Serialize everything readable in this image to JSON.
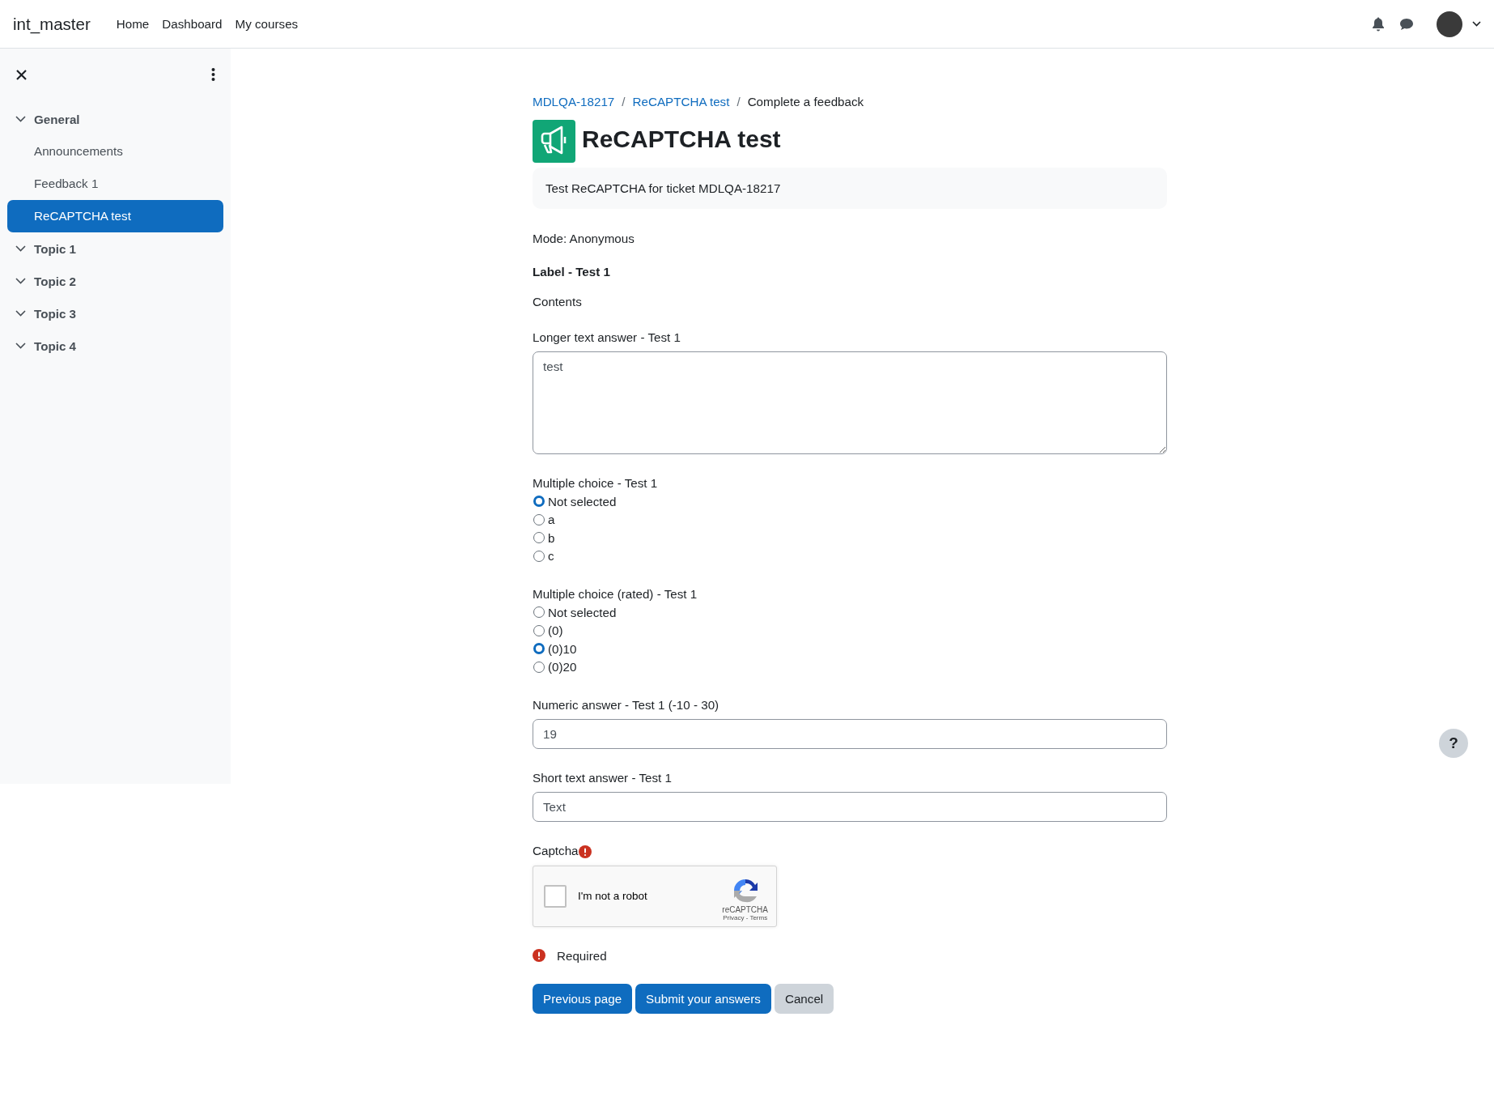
{
  "navbar": {
    "site_name": "int_master",
    "links": [
      {
        "label": "Home"
      },
      {
        "label": "Dashboard"
      },
      {
        "label": "My courses"
      }
    ]
  },
  "sidebar": {
    "sections": [
      {
        "title": "General",
        "expanded": true,
        "children": [
          {
            "label": "Announcements",
            "selected": false
          },
          {
            "label": "Feedback 1",
            "selected": false
          },
          {
            "label": "ReCAPTCHA test",
            "selected": true
          }
        ]
      },
      {
        "title": "Topic 1",
        "expanded": true
      },
      {
        "title": "Topic 2",
        "expanded": true
      },
      {
        "title": "Topic 3",
        "expanded": true
      },
      {
        "title": "Topic 4",
        "expanded": true
      }
    ]
  },
  "main": {
    "breadcrumb": [
      {
        "label": "MDLQA-18217",
        "link": true
      },
      {
        "label": "ReCAPTCHA test",
        "link": true
      },
      {
        "label": "Complete a feedback",
        "link": false
      }
    ],
    "breadcrumb_separator": "/",
    "title": "ReCAPTCHA test",
    "description": "Test ReCAPTCHA for ticket MDLQA-18217",
    "mode": "Mode: Anonymous",
    "items": [
      {
        "kind": "label",
        "title": "Label - Test 1",
        "text": "Contents"
      },
      {
        "kind": "textarea",
        "label": "Longer text answer - Test 1",
        "value": "test"
      },
      {
        "kind": "radio",
        "label": "Multiple choice - Test 1",
        "options": [
          {
            "label": "Not selected",
            "selected": true
          },
          {
            "label": "a",
            "selected": false
          },
          {
            "label": "b",
            "selected": false
          },
          {
            "label": "c",
            "selected": false
          }
        ]
      },
      {
        "kind": "radio",
        "label": "Multiple choice (rated) - Test 1",
        "options": [
          {
            "label": "Not selected",
            "selected": false
          },
          {
            "label": "(0)",
            "selected": false
          },
          {
            "label": "(0)10",
            "selected": true
          },
          {
            "label": "(0)20",
            "selected": false
          }
        ]
      },
      {
        "kind": "input",
        "label": "Numeric answer - Test 1 (-10 - 30)",
        "value": "19"
      },
      {
        "kind": "input",
        "label": "Short text answer - Test 1",
        "value": "Text"
      },
      {
        "kind": "captcha",
        "label": "Captcha",
        "required": true,
        "checked": false,
        "checkbox_label": "I'm not a robot",
        "brand": "reCAPTCHA",
        "privacy": "Privacy",
        "separator": "-",
        "terms": "Terms"
      }
    ],
    "required_note": "Required",
    "buttons": [
      {
        "label": "Previous page",
        "kind": "primary"
      },
      {
        "label": "Submit your answers",
        "kind": "primary"
      },
      {
        "label": "Cancel",
        "kind": "secondary"
      }
    ]
  },
  "help_button": "?"
}
